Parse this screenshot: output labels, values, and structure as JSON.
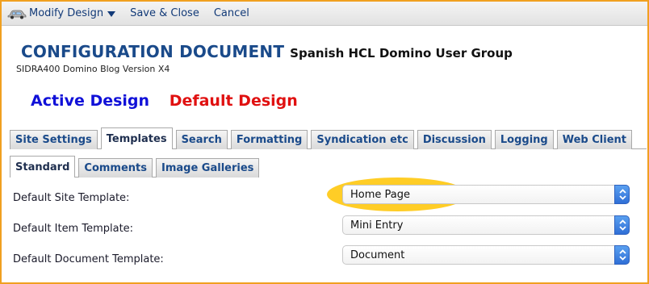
{
  "toolbar": {
    "modify_design": "Modify Design",
    "save_close": "Save & Close",
    "cancel": "Cancel",
    "icons": {
      "design": "car-icon",
      "dropdown": "caret-down-icon"
    }
  },
  "header": {
    "title": "CONFIGURATION DOCUMENT",
    "subtitle": "Spanish HCL Domino User Group",
    "version": "SIDRA400 Domino Blog Version X4"
  },
  "design": {
    "active": "Active Design",
    "default": "Default Design",
    "active_color": "#1010d8",
    "default_color": "#e01010"
  },
  "tabs": [
    {
      "label": "Site Settings",
      "active": false
    },
    {
      "label": "Templates",
      "active": true
    },
    {
      "label": "Search",
      "active": false
    },
    {
      "label": "Formatting",
      "active": false
    },
    {
      "label": "Syndication etc",
      "active": false
    },
    {
      "label": "Discussion",
      "active": false
    },
    {
      "label": "Logging",
      "active": false
    },
    {
      "label": "Web Client",
      "active": false
    }
  ],
  "subtabs": [
    {
      "label": "Standard",
      "active": true
    },
    {
      "label": "Comments",
      "active": false
    },
    {
      "label": "Image Galleries",
      "active": false
    }
  ],
  "fields": [
    {
      "label": "Default Site Template:",
      "value": "Home Page"
    },
    {
      "label": "Default Item Template:",
      "value": "Mini Entry"
    },
    {
      "label": "Default Document Template:",
      "value": "Document"
    }
  ],
  "colors": {
    "frame": "#f0a020",
    "link": "#123a78",
    "title": "#1a4a8a",
    "highlight": "#ffc400",
    "select_stepper": "#2f6fd6"
  }
}
